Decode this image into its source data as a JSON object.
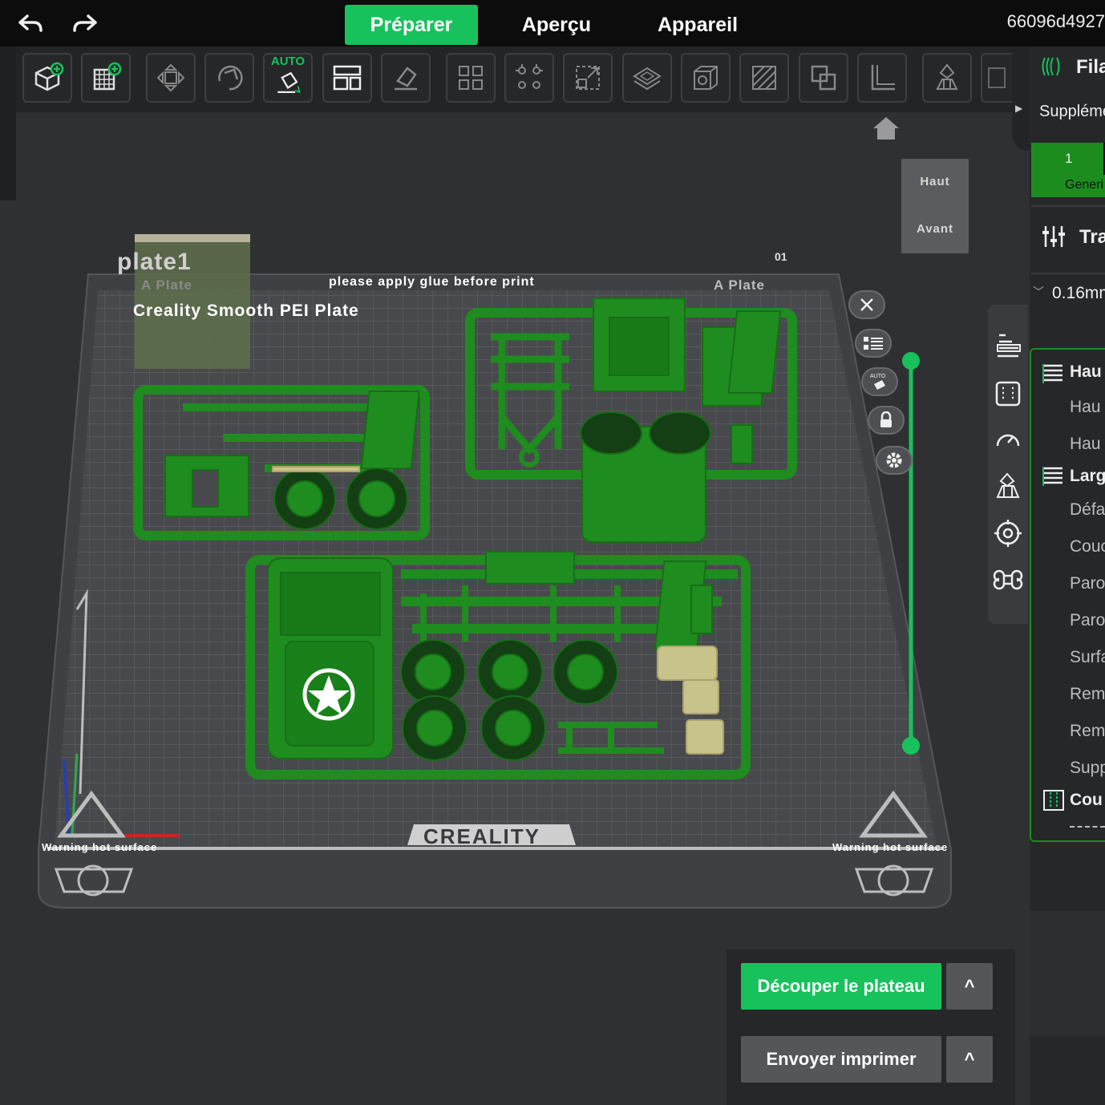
{
  "topbar": {
    "tabs": [
      "Préparer",
      "Aperçu",
      "Appareil"
    ],
    "active_tab": "Préparer",
    "device_id": "66096d4927"
  },
  "colors": {
    "accent": "#17c25c",
    "model_green": "#1f8c1f",
    "model_tan": "#c8c38a",
    "bed_grid": "#5a5b5e"
  },
  "toolbar": {
    "auto_label": "AUTO",
    "icons": [
      "add-object-icon",
      "add-plate-icon",
      "arrange-icon",
      "orient-icon",
      "auto-orient-icon",
      "layout-icon",
      "erase-icon",
      "split-objects-icon",
      "split-parts-icon",
      "scale-icon",
      "cut-icon",
      "hollow-icon",
      "paint-icon",
      "boolean-icon",
      "measure-icon",
      "support-paint-icon",
      "more-icon"
    ]
  },
  "viewcube": {
    "top": "Haut",
    "front": "Avant"
  },
  "plate": {
    "name": "plate1",
    "plate_type_left": "A Plate",
    "plate_type_right": "A Plate",
    "glue_note": "please apply glue before print",
    "surface": "Creality Smooth PEI Plate",
    "brand": "CREALITY",
    "warning_left": "Warning hot surface",
    "warning_right": "Warning hot surface",
    "plate_index": "01"
  },
  "right_panel": {
    "filament_title": "Fila",
    "supplement": "Suppléme",
    "filament_slot_number": "1",
    "filament_slot_label": "Generi",
    "process_title": "Tra",
    "layer_preset": "0.16mm",
    "items": [
      {
        "label": "Hau",
        "header": true
      },
      {
        "label": "Hau",
        "header": false
      },
      {
        "label": "Hau",
        "header": false
      },
      {
        "label": "Larg",
        "header": true
      },
      {
        "label": "Défa",
        "header": false
      },
      {
        "label": "Couc",
        "header": false
      },
      {
        "label": "Paro",
        "header": false
      },
      {
        "label": "Paro",
        "header": false
      },
      {
        "label": "Surfa",
        "header": false
      },
      {
        "label": "Rem",
        "header": false
      },
      {
        "label": "Rem",
        "header": false
      },
      {
        "label": "Supp",
        "header": false
      },
      {
        "label": "Cou",
        "header": true
      }
    ]
  },
  "actions": {
    "slice": "Découper le plateau",
    "send": "Envoyer imprimer",
    "caret": "^"
  }
}
